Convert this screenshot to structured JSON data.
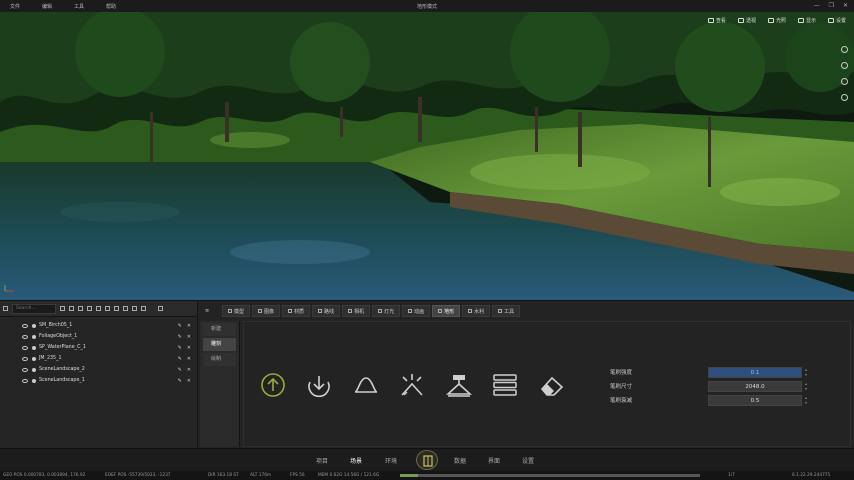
{
  "menubar": {
    "items": [
      "文件",
      "编辑",
      "工具",
      "帮助"
    ],
    "title": "地形模式",
    "window_controls": [
      "—",
      "❐",
      "✕"
    ]
  },
  "viewport": {
    "topbar": [
      {
        "label": "查看",
        "icon": "view-icon"
      },
      {
        "label": "透视",
        "icon": "perspective-icon"
      },
      {
        "label": "光照",
        "icon": "lighting-icon"
      },
      {
        "label": "显示",
        "icon": "display-icon"
      },
      {
        "label": "设置",
        "icon": "settings-icon"
      }
    ],
    "side_icons": [
      "plus-icon",
      "globe-icon",
      "world-icon",
      "camera-icon"
    ]
  },
  "outliner": {
    "search_placeholder": "Search...",
    "rows": [
      "SM_Birch05_1",
      "FoliageObject_1",
      "SP_WaterPlane_C_1",
      "JM_235_1",
      "SceneLandscape_2",
      "SceneLandscape_1"
    ]
  },
  "tabs": [
    {
      "label": "模型"
    },
    {
      "label": "图像"
    },
    {
      "label": "材质"
    },
    {
      "label": "路线"
    },
    {
      "label": "相机"
    },
    {
      "label": "灯光"
    },
    {
      "label": "动画"
    },
    {
      "label": "地形",
      "active": true
    },
    {
      "label": "水利"
    },
    {
      "label": "工具"
    }
  ],
  "subnav": [
    "新建",
    "雕刻",
    "绘制"
  ],
  "tools": [
    {
      "name": "raise",
      "icon": "raise-icon",
      "active": true
    },
    {
      "name": "lower",
      "icon": "lower-icon"
    },
    {
      "name": "smooth",
      "icon": "smooth-icon"
    },
    {
      "name": "flatten",
      "icon": "flatten-icon"
    },
    {
      "name": "ramp",
      "icon": "ramp-icon"
    },
    {
      "name": "erosion",
      "icon": "erosion-icon"
    },
    {
      "name": "erase",
      "icon": "eraser-icon"
    }
  ],
  "params": [
    {
      "label": "笔刷强度",
      "value": "0.1",
      "active": true
    },
    {
      "label": "笔刷尺寸",
      "value": "2048.0"
    },
    {
      "label": "笔刷衰减",
      "value": "0.5"
    }
  ],
  "bottomnav": {
    "items": [
      "项目",
      "场景",
      "环境",
      "数据",
      "界面",
      "设置"
    ],
    "active": "场景"
  },
  "status": {
    "geo_pos": "GEO POS   0.000783, 0.003894, 176.92",
    "eoef": "EOEF POS   -55739/5023, -1237",
    "dir": "DIR   163.18 ST",
    "alt": "ALT   176m",
    "fps": "FPS   56",
    "mem": "MEM   0.62G  14.56G / 121.6G",
    "page": "1/7",
    "version": "6.1.22.29.244775"
  },
  "colors": {
    "accent_tool": "#9bab3a",
    "active_param": "#2f4f7f",
    "grass": "#5f8f35",
    "water": "#264e6e"
  }
}
